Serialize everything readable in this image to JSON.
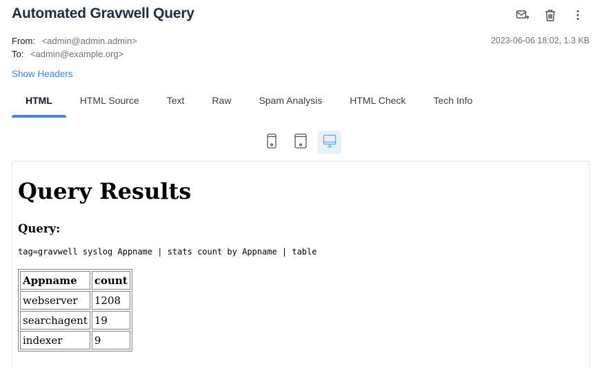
{
  "email": {
    "subject": "Automated Gravwell Query",
    "from_label": "From:",
    "from_value": "<admin@admin.admin>",
    "to_label": "To:",
    "to_value": "<admin@example.org>",
    "date_size": "2023-06-06 18:02, 1.3 KB",
    "show_headers": "Show Headers"
  },
  "tabs": [
    {
      "label": "HTML",
      "active": true
    },
    {
      "label": "HTML Source"
    },
    {
      "label": "Text"
    },
    {
      "label": "Raw"
    },
    {
      "label": "Spam Analysis"
    },
    {
      "label": "HTML Check"
    },
    {
      "label": "Tech Info"
    }
  ],
  "devices": {
    "active": "desktop"
  },
  "preview": {
    "title": "Query Results",
    "query_heading": "Query:",
    "query": "tag=gravwell syslog Appname | stats count by Appname | table",
    "columns": [
      "Appname",
      "count"
    ],
    "rows": [
      [
        "webserver",
        "1208"
      ],
      [
        "searchagent",
        "19"
      ],
      [
        "indexer",
        "9"
      ]
    ]
  }
}
